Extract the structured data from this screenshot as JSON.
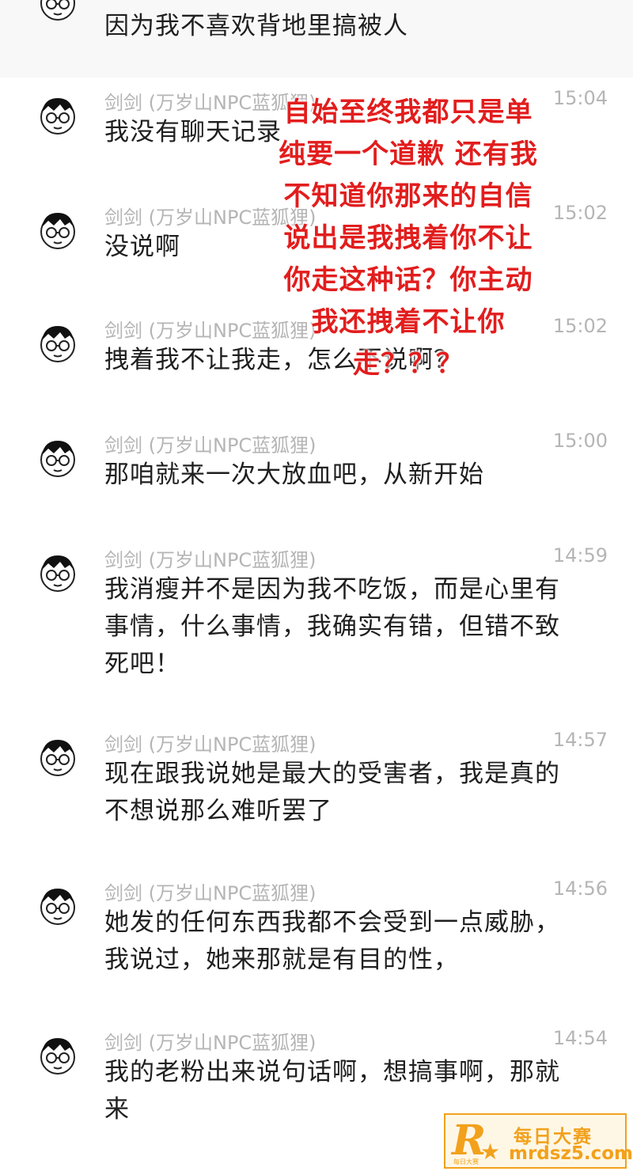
{
  "colors": {
    "overlay_text": "#e21d1d",
    "meta_text": "#b5b5b5",
    "message_text": "#1f1f1f",
    "watermark": "#f2a11c"
  },
  "top_message": {
    "text": "因为我不喜欢背地里搞被人"
  },
  "messages": [
    {
      "sender": "剑剑 (万岁山NPC蓝狐狸)",
      "time": "15:04",
      "lines": [
        "我没有聊天记录"
      ]
    },
    {
      "sender": "剑剑 (万岁山NPC蓝狐狸)",
      "time": "15:02",
      "lines": [
        "没说啊"
      ]
    },
    {
      "sender": "剑剑 (万岁山NPC蓝狐狸)",
      "time": "15:02",
      "lines": [
        "拽着我不让我走，怎么不说啊？"
      ]
    },
    {
      "sender": "剑剑 (万岁山NPC蓝狐狸)",
      "time": "15:00",
      "lines": [
        "那咱就来一次大放血吧，从新开始"
      ]
    },
    {
      "sender": "剑剑 (万岁山NPC蓝狐狸)",
      "time": "14:59",
      "lines": [
        "我消瘦并不是因为我不吃饭，而是心里有",
        "事情，什么事情，我确实有错，但错不致",
        "死吧！"
      ]
    },
    {
      "sender": "剑剑 (万岁山NPC蓝狐狸)",
      "time": "14:57",
      "lines": [
        "现在跟我说她是最大的受害者，我是真的",
        "不想说那么难听罢了"
      ]
    },
    {
      "sender": "剑剑 (万岁山NPC蓝狐狸)",
      "time": "14:56",
      "lines": [
        "她发的任何东西我都不会受到一点威胁，",
        "我说过，她来那就是有目的性，"
      ]
    },
    {
      "sender": "剑剑 (万岁山NPC蓝狐狸)",
      "time": "14:54",
      "lines": [
        "我的老粉出来说句话啊，想搞事啊，那就",
        "来"
      ]
    }
  ],
  "overlay_note": {
    "lines": [
      "自始至终我都只是单",
      "纯要一个道歉 还有我",
      "不知道你那来的自信",
      "说出是我拽着你不让",
      "你走这种话？你主动",
      "我还拽着不让你",
      "走？？？"
    ]
  },
  "watermark": {
    "logo_letter": "R",
    "logo_small": "每日大赛",
    "title": "每日大赛",
    "url": "mrdsz5.com"
  }
}
